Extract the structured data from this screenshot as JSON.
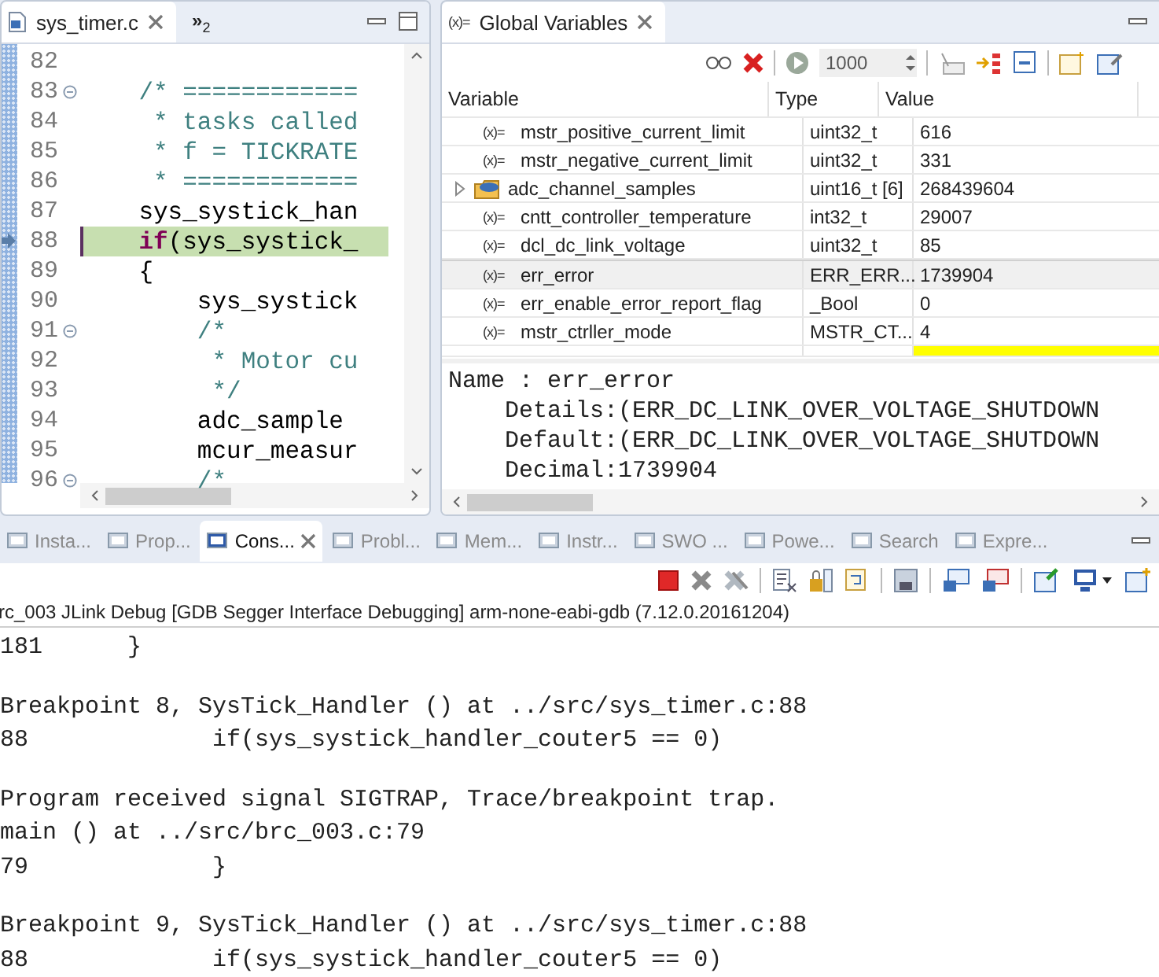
{
  "editor": {
    "tab": {
      "title": "sys_timer.c",
      "selected": true
    },
    "overflow": {
      "label": "»",
      "count": "2"
    },
    "lines": [
      {
        "number": "82",
        "fold": false,
        "current": false
      },
      {
        "number": "83",
        "fold": true,
        "current": false,
        "tokens": [
          {
            "text": "    /* ============",
            "kind": "comment"
          }
        ]
      },
      {
        "number": "84",
        "fold": false,
        "current": false,
        "tokens": [
          {
            "text": "     * tasks called",
            "kind": "comment"
          }
        ]
      },
      {
        "number": "85",
        "fold": false,
        "current": false,
        "tokens": [
          {
            "text": "     * f = TICKRATE",
            "kind": "comment"
          }
        ]
      },
      {
        "number": "86",
        "fold": false,
        "current": false,
        "tokens": [
          {
            "text": "     * ============",
            "kind": "comment"
          }
        ]
      },
      {
        "number": "87",
        "fold": false,
        "current": false,
        "tokens": [
          {
            "text": "    sys_systick_han",
            "kind": "plain"
          }
        ]
      },
      {
        "number": "88",
        "fold": false,
        "current": true,
        "tokens": [
          {
            "text": "    if",
            "kind": "keyword"
          },
          {
            "text": "(sys_systick_",
            "kind": "plain"
          }
        ]
      },
      {
        "number": "89",
        "fold": false,
        "current": false,
        "tokens": [
          {
            "text": "    {",
            "kind": "plain"
          }
        ]
      },
      {
        "number": "90",
        "fold": false,
        "current": false,
        "tokens": [
          {
            "text": "        sys_systick",
            "kind": "plain"
          }
        ]
      },
      {
        "number": "91",
        "fold": true,
        "current": false,
        "tokens": [
          {
            "text": "        /*",
            "kind": "comment"
          }
        ]
      },
      {
        "number": "92",
        "fold": false,
        "current": false,
        "tokens": [
          {
            "text": "         * Motor cu",
            "kind": "comment"
          }
        ]
      },
      {
        "number": "93",
        "fold": false,
        "current": false,
        "tokens": [
          {
            "text": "         */",
            "kind": "comment"
          }
        ]
      },
      {
        "number": "94",
        "fold": false,
        "current": false,
        "tokens": [
          {
            "text": "        adc_sample",
            "kind": "plain"
          }
        ]
      },
      {
        "number": "95",
        "fold": false,
        "current": false,
        "tokens": [
          {
            "text": "        mcur_measur",
            "kind": "plain"
          }
        ]
      },
      {
        "number": "96",
        "fold": true,
        "current": false,
        "tokens": [
          {
            "text": "        /*",
            "kind": "comment"
          }
        ]
      }
    ]
  },
  "variables": {
    "tab": {
      "icon_text": "(x)=",
      "title": "Global Variables"
    },
    "refresh_interval": "1000",
    "columns": [
      "Variable",
      "Type",
      "Value"
    ],
    "rows": [
      {
        "kind": "variable",
        "icon_text": "(x)=",
        "name": "mstr_positive_current_limit",
        "type": "uint32_t",
        "value": "616",
        "selected": false,
        "changed": false
      },
      {
        "kind": "variable",
        "icon_text": "(x)=",
        "name": "mstr_negative_current_limit",
        "type": "uint32_t",
        "value": "331",
        "selected": false,
        "changed": false
      },
      {
        "kind": "array",
        "expanded": false,
        "name": "adc_channel_samples",
        "type": "uint16_t [6]",
        "value": "268439604",
        "selected": false,
        "changed": false
      },
      {
        "kind": "variable",
        "icon_text": "(x)=",
        "name": "cntt_controller_temperature",
        "type": "int32_t",
        "value": "29007",
        "selected": false,
        "changed": false
      },
      {
        "kind": "variable",
        "icon_text": "(x)=",
        "name": "dcl_dc_link_voltage",
        "type": "uint32_t",
        "value": "85",
        "selected": false,
        "changed": false
      },
      {
        "kind": "variable",
        "icon_text": "(x)=",
        "name": "err_error",
        "type": "ERR_ERR...",
        "value": "1739904",
        "selected": true,
        "changed": false
      },
      {
        "kind": "variable",
        "icon_text": "(x)=",
        "name": "err_enable_error_report_flag",
        "type": "_Bool",
        "value": "0",
        "selected": false,
        "changed": false
      },
      {
        "kind": "variable",
        "icon_text": "(x)=",
        "name": "mstr_ctrller_mode",
        "type": "MSTR_CT...",
        "value": "4",
        "selected": false,
        "changed": false
      }
    ],
    "partial_row": {
      "changed": true
    },
    "details": [
      "Name : err_error",
      "    Details:(ERR_DC_LINK_OVER_VOLTAGE_SHUTDOWN",
      "    Default:(ERR_DC_LINK_OVER_VOLTAGE_SHUTDOWN",
      "    Decimal:1739904"
    ]
  },
  "console": {
    "tabs": [
      {
        "label": "Insta...",
        "selected": false
      },
      {
        "label": "Prop...",
        "selected": false
      },
      {
        "label": "Cons...",
        "selected": true
      },
      {
        "label": "Probl...",
        "selected": false
      },
      {
        "label": "Mem...",
        "selected": false
      },
      {
        "label": "Instr...",
        "selected": false
      },
      {
        "label": "SWO ...",
        "selected": false
      },
      {
        "label": "Powe...",
        "selected": false
      },
      {
        "label": "Search",
        "selected": false
      },
      {
        "label": "Expre...",
        "selected": false
      }
    ],
    "header": "rc_003 JLink Debug [GDB Segger Interface Debugging] arm-none-eabi-gdb (7.12.0.20161204)",
    "blocks": [
      [
        "181      }"
      ],
      [
        "Breakpoint 8, SysTick_Handler () at ../src/sys_timer.c:88",
        "88             if(sys_systick_handler_couter5 == 0)"
      ],
      [
        "Program received signal SIGTRAP, Trace/breakpoint trap.",
        "main () at ../src/brc_003.c:79",
        "79             }"
      ],
      [
        "Breakpoint 9, SysTick_Handler () at ../src/sys_timer.c:88",
        "88             if(sys_systick_handler_couter5 == 0)"
      ]
    ]
  }
}
